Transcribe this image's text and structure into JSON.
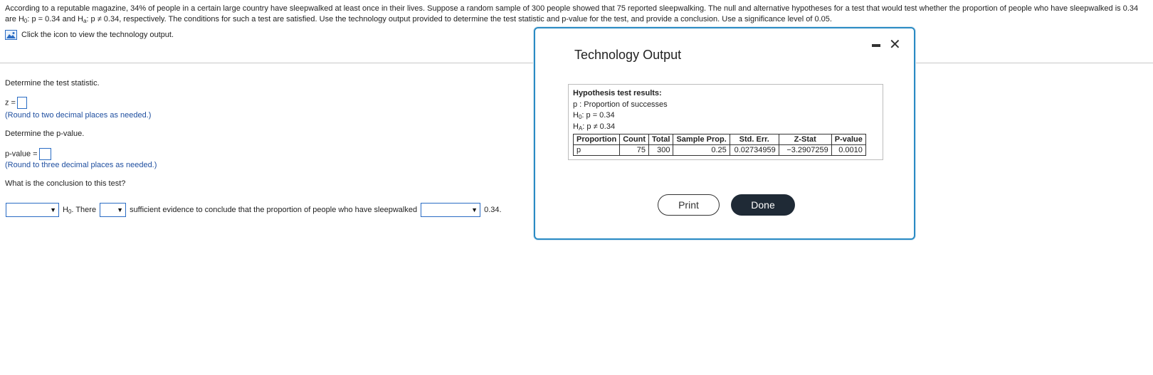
{
  "problem": {
    "text_a": "According to a reputable magazine, 34% of people in a certain large country have sleepwalked at least once in their lives. Suppose a random sample of 300 people showed that 75 reported sleepwalking. The null and alternative hypotheses for a test that would test whether the proportion of people who have sleepwalked is 0.34 are H",
    "sub0": "0",
    "text_b": ": p = 0.34 and H",
    "suba": "a",
    "text_c": ": p ≠ 0.34, respectively. The conditions for such a test are satisfied. Use the technology output provided to determine the test statistic and p-value for the test, and provide a conclusion. Use a significance level of 0.05."
  },
  "tech_link": {
    "label": "Click the icon to view the technology output."
  },
  "questions": {
    "q1": "Determine the test statistic.",
    "z_label": "z =",
    "hint1": "(Round to two decimal places as needed.)",
    "q2": "Determine the p-value.",
    "p_label": "p-value =",
    "hint2": "(Round to three decimal places as needed.)",
    "q3": "What is the conclusion to this test?"
  },
  "conclusion": {
    "h": "H",
    "h_sub": "0",
    "after_h": ". There",
    "middle": "sufficient evidence to conclude that the proportion of people who have sleepwalked",
    "end": "0.34."
  },
  "modal": {
    "title": "Technology Output",
    "output": {
      "header": "Hypothesis test results:",
      "line1": "p : Proportion of successes",
      "h0_prefix": "H",
      "h0_sub": "0",
      "h0_rest": ": p = 0.34",
      "ha_prefix": "H",
      "ha_sub": "A",
      "ha_rest": ": p ≠ 0.34",
      "columns": [
        "Proportion",
        "Count",
        "Total",
        "Sample Prop.",
        "Std. Err.",
        "Z-Stat",
        "P-value"
      ],
      "row": [
        "p",
        "75",
        "300",
        "0.25",
        "0.02734959",
        "−3.2907259",
        "0.0010"
      ]
    },
    "print_label": "Print",
    "done_label": "Done"
  },
  "colors": {
    "accent": "#2a6cc4",
    "modal_border": "#2a8bc4",
    "done_bg": "#1f2a36"
  }
}
